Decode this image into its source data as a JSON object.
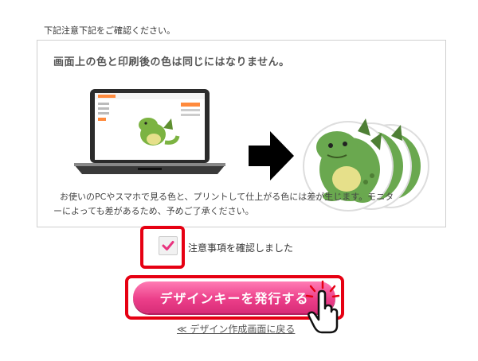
{
  "intro": "下記注意下記をご確認ください。",
  "notice": {
    "heading": "画面上の色と印刷後の色は同じにはなりません。",
    "body_line1": "お使いのPCやスマホで見る色と、プリントして仕上がる色には差が生じます。モニタ",
    "body_line2": "ーによっても差があるため、予めご了承ください。"
  },
  "confirm": {
    "checked": true,
    "label": "注意事項を確認しました"
  },
  "issue_button": {
    "label": "デザインキーを発行する"
  },
  "back_link": {
    "label": "≪ デザイン作成画面に戻る"
  },
  "colors": {
    "highlight_red": "#e60012",
    "button_pink": "#ec3f8a",
    "check_mark": "#e8347f"
  },
  "icons": [
    "laptop-icon",
    "arrow-right-icon",
    "dinosaur-sticker-image",
    "checkmark-icon",
    "pointer-hand-icon"
  ]
}
